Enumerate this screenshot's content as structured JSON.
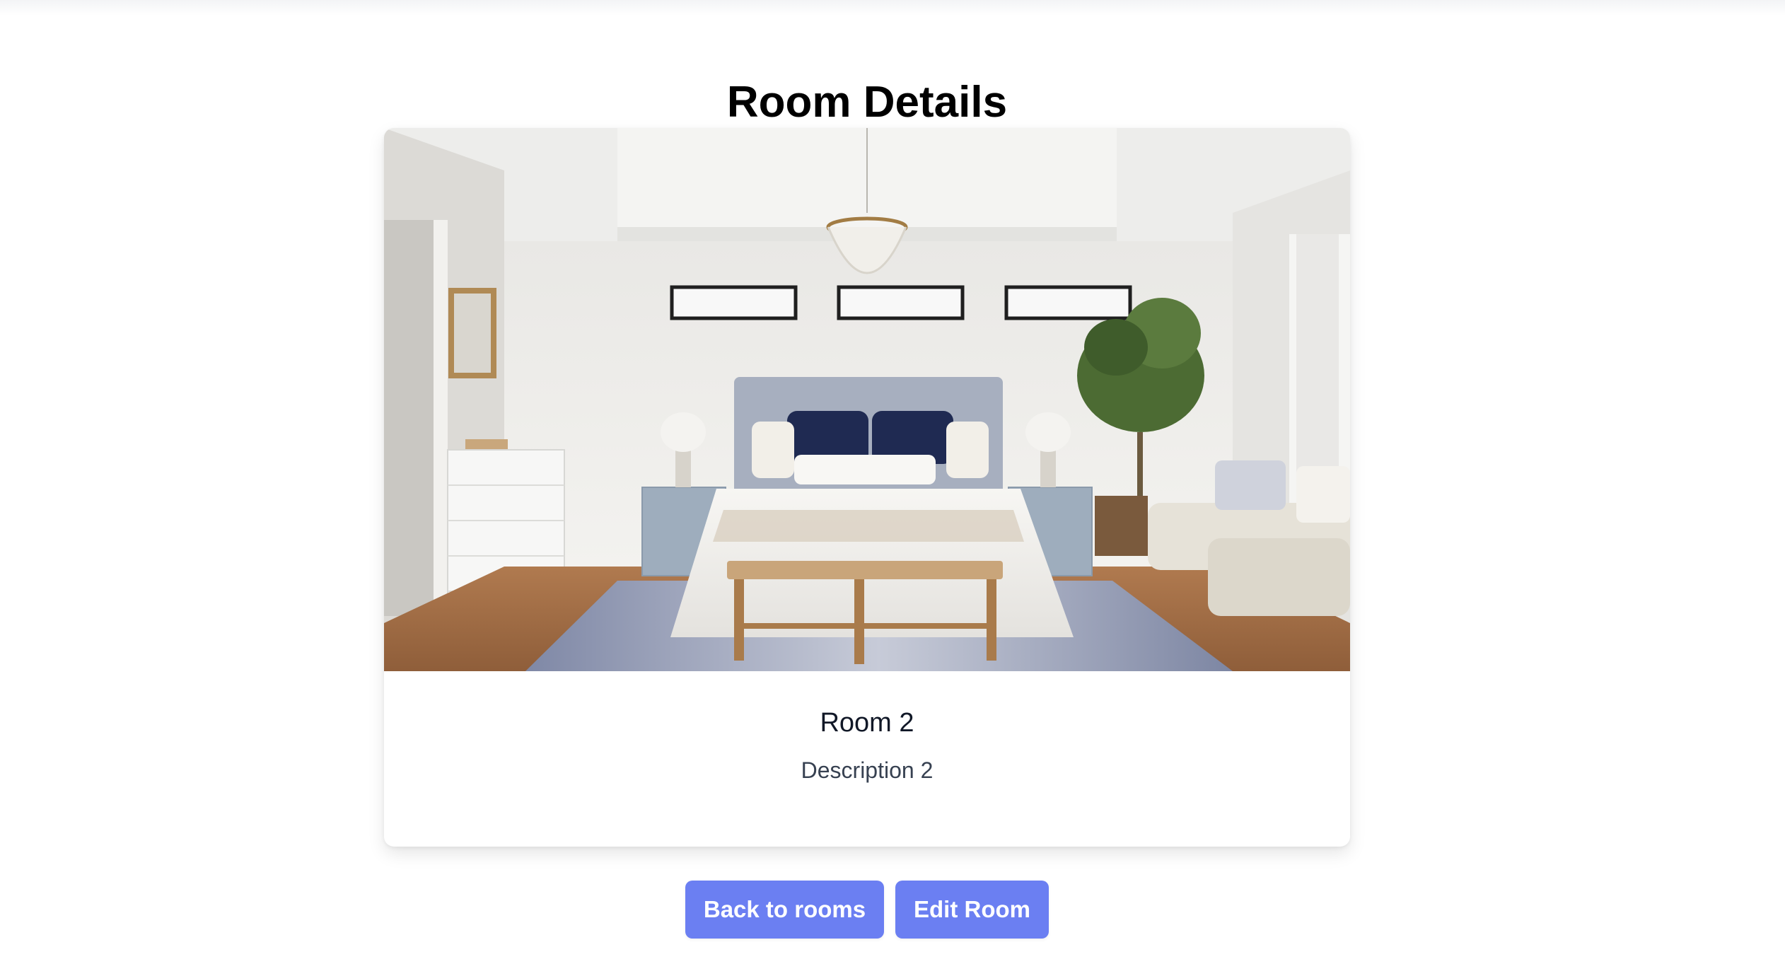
{
  "page": {
    "title": "Room Details"
  },
  "room": {
    "name": "Room 2",
    "description": "Description 2",
    "image_subject": "bedroom-photo"
  },
  "actions": {
    "back_label": "Back to rooms",
    "edit_label": "Edit Room"
  },
  "colors": {
    "button_bg": "#6b7ff2",
    "button_text": "#ffffff",
    "title_text": "#000000"
  }
}
